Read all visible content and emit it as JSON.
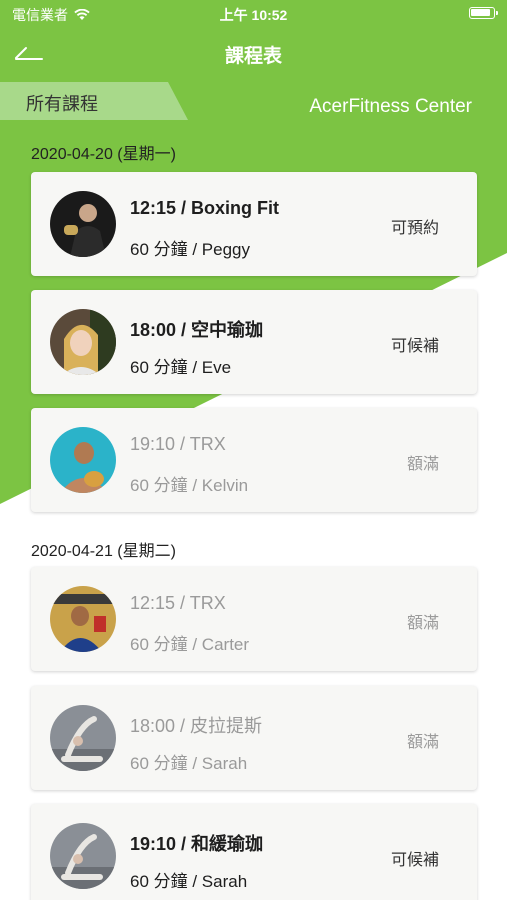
{
  "status_bar": {
    "carrier": "電信業者",
    "time": "上午 10:52"
  },
  "nav": {
    "title": "課程表",
    "back_icon": "back-arrow-icon"
  },
  "tabs": {
    "all_courses": "所有課程",
    "center_name": "AcerFitness Center"
  },
  "colors": {
    "brand_green": "#7cc443",
    "tab_light_green": "#a8d98a",
    "card_bg": "#f7f7f5",
    "full_text": "#9a9a9a"
  },
  "days": [
    {
      "date": "2020-04-20 (星期一)",
      "classes": [
        {
          "title": "12:15 / Boxing Fit",
          "subtitle": "60 分鐘 / Peggy",
          "status": "可預約",
          "full": false
        },
        {
          "title": "18:00 / 空中瑜珈",
          "subtitle": "60 分鐘 / Eve",
          "status": "可候補",
          "full": false
        },
        {
          "title": "19:10 / TRX",
          "subtitle": "60 分鐘 / Kelvin",
          "status": "額滿",
          "full": true
        }
      ]
    },
    {
      "date": "2020-04-21 (星期二)",
      "classes": [
        {
          "title": "12:15 / TRX",
          "subtitle": "60 分鐘 / Carter",
          "status": "額滿",
          "full": true
        },
        {
          "title": "18:00 / 皮拉提斯",
          "subtitle": "60 分鐘 / Sarah",
          "status": "額滿",
          "full": true
        },
        {
          "title": "19:10 / 和緩瑜珈",
          "subtitle": "60 分鐘 / Sarah",
          "status": "可候補",
          "full": false
        }
      ]
    }
  ]
}
